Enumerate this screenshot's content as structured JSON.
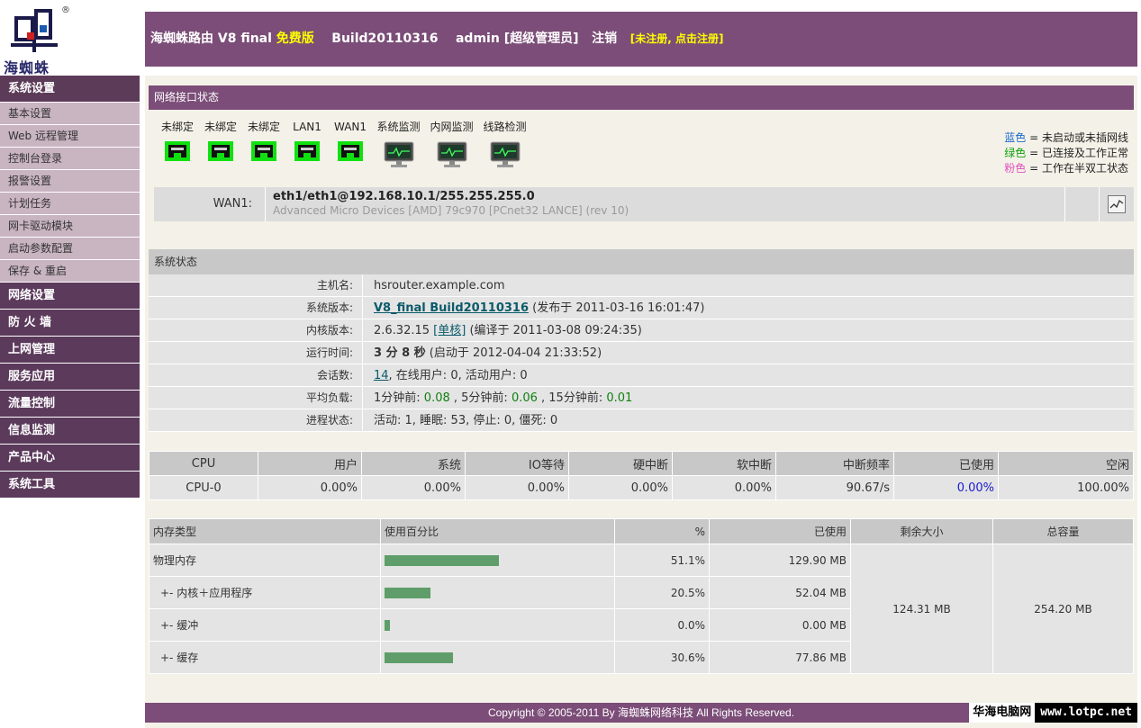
{
  "brand": {
    "name": "海蜘蛛",
    "reg_mark": "®"
  },
  "header": {
    "product": "海蜘蛛路由 V8 final",
    "edition": "免费版",
    "build": "Build20110316",
    "user": "admin",
    "role": "[超级管理员]",
    "logout": "注销",
    "register": "[未注册, 点击注册]"
  },
  "sidebar": {
    "system_settings": "系统设置",
    "items": [
      "基本设置",
      "Web 远程管理",
      "控制台登录",
      "报警设置",
      "计划任务",
      "网卡驱动模块",
      "启动参数配置",
      "保存 & 重启"
    ],
    "categories": [
      "网络设置",
      "防 火 墙",
      "上网管理",
      "服务应用",
      "流量控制",
      "信息监测",
      "产品中心",
      "系统工具"
    ]
  },
  "net": {
    "title": "网络接口状态",
    "ports": [
      {
        "label": "未绑定",
        "type": "port"
      },
      {
        "label": "未绑定",
        "type": "port"
      },
      {
        "label": "未绑定",
        "type": "port"
      },
      {
        "label": "LAN1",
        "type": "port"
      },
      {
        "label": "WAN1",
        "type": "port"
      },
      {
        "label": "系统监测",
        "type": "monitor"
      },
      {
        "label": "内网监测",
        "type": "monitor"
      },
      {
        "label": "线路检测",
        "type": "monitor"
      }
    ],
    "legend": {
      "blue_word": "蓝色",
      "blue_text": " = 未启动或未插网线",
      "green_word": "绿色",
      "green_text": " = 已连接及工作正常",
      "pink_word": "粉色",
      "pink_text": " = 工作在半双工状态"
    },
    "wan": {
      "label": "WAN1:",
      "address": "eth1/eth1@192.168.10.1/255.255.255.0",
      "device": "Advanced Micro Devices [AMD] 79c970 [PCnet32 LANCE] (rev 10)"
    }
  },
  "sys": {
    "title": "系统状态",
    "hostname_label": "主机名:",
    "hostname": "hsrouter.example.com",
    "version_label": "系统版本:",
    "version_link": "V8_final Build20110316",
    "version_rest": " (发布于 2011-03-16 16:01:47)",
    "kernel_label": "内核版本:",
    "kernel": "2.6.32.15 ",
    "kernel_link": "[单核]",
    "kernel_rest": " (编译于 2011-03-08 09:24:35)",
    "uptime_label": "运行时间:",
    "uptime": "3 分 8 秒",
    "uptime_rest": " (启动于 2012-04-04 21:33:52)",
    "sessions_label": "会话数:",
    "sessions_link": "14",
    "sessions_rest": ",  在线用户: 0,  活动用户: 0",
    "load_label": "平均负载:",
    "load_1": "1分钟前: ",
    "load_1v": "0.08",
    "load_5": " , 5分钟前: ",
    "load_5v": "0.06",
    "load_15": " , 15分钟前: ",
    "load_15v": "0.01",
    "proc_label": "进程状态:",
    "proc": "活动: 1, 睡眠: 53, 停止: 0, 僵死: 0"
  },
  "cpu": {
    "headers": [
      "CPU",
      "用户",
      "系统",
      "IO等待",
      "硬中断",
      "软中断",
      "中断频率",
      "已使用",
      "空闲"
    ],
    "row": [
      "CPU-0",
      "0.00%",
      "0.00%",
      "0.00%",
      "0.00%",
      "0.00%",
      "90.67/s",
      "0.00%",
      "100.00%"
    ]
  },
  "mem": {
    "headers": [
      "内存类型",
      "使用百分比",
      "%",
      "已使用",
      "剩余大小",
      "总容量"
    ],
    "rows": [
      {
        "type": "物理内存",
        "pct": "51.1%",
        "frac": 0.511,
        "used": "129.90 MB"
      },
      {
        "type": "+- 内核＋应用程序",
        "pct": "20.5%",
        "frac": 0.205,
        "used": "52.04 MB"
      },
      {
        "type": "+- 缓冲",
        "pct": "0.0%",
        "frac": 0.0,
        "used": "0.00 MB"
      },
      {
        "type": "+- 缓存",
        "pct": "30.6%",
        "frac": 0.306,
        "used": "77.86 MB"
      }
    ],
    "free": "124.31 MB",
    "total": "254.20 MB"
  },
  "footer": "Copyright © 2005-2011 By  海蜘蛛网络科技  All Rights Reserved.",
  "watermark": {
    "cn": "华海电脑网",
    "url": "www.lotpc.net"
  }
}
